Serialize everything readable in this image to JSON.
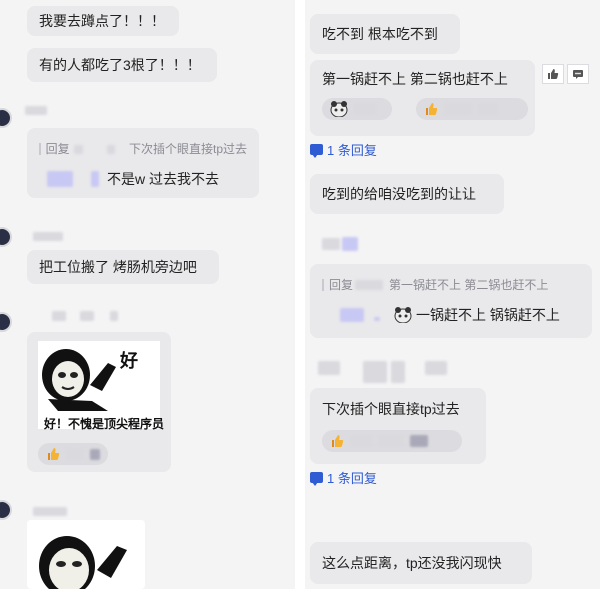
{
  "left": {
    "messages": [
      {
        "text": "我要去蹲点了！！！"
      },
      {
        "text": "有的人都吃了3根了！！！"
      }
    ],
    "quoted_reply": {
      "quote_prefix": "回复",
      "quote_text": "下次插个眼直接tp过去",
      "reply_text": "不是w 过去我不去"
    },
    "message3": {
      "text": "把工位搬了 烤肠机旁边吧"
    },
    "sticker": {
      "handwriting": "好",
      "caption": "好！不愧是顶尖程序员"
    }
  },
  "right": {
    "messages": [
      {
        "text": "吃不到 根本吃不到"
      },
      {
        "text": "第一锅赶不上 第二锅也赶不上"
      }
    ],
    "reply_count_label": "1 条回复",
    "message3": {
      "text": "吃到的给咱没吃到的让让"
    },
    "quoted_reply": {
      "quote_prefix": "回复",
      "quote_text": "第一锅赶不上 第二锅也赶不上",
      "reply_text": "一锅赶不上 锅锅赶不上"
    },
    "message5": {
      "text": "下次插个眼直接tp过去"
    },
    "reply_count_label_2": "1 条回复",
    "message6": {
      "text": "这么点距离，tp还没我闪现快"
    }
  },
  "colors": {
    "bubble": "#e9e9eb",
    "background": "#f4f4f5",
    "link": "#2f5bd3"
  },
  "icons": [
    "thumbs-up-icon",
    "more-icon",
    "reply-icon",
    "thumbs-up-emoji",
    "panda-emoji"
  ]
}
